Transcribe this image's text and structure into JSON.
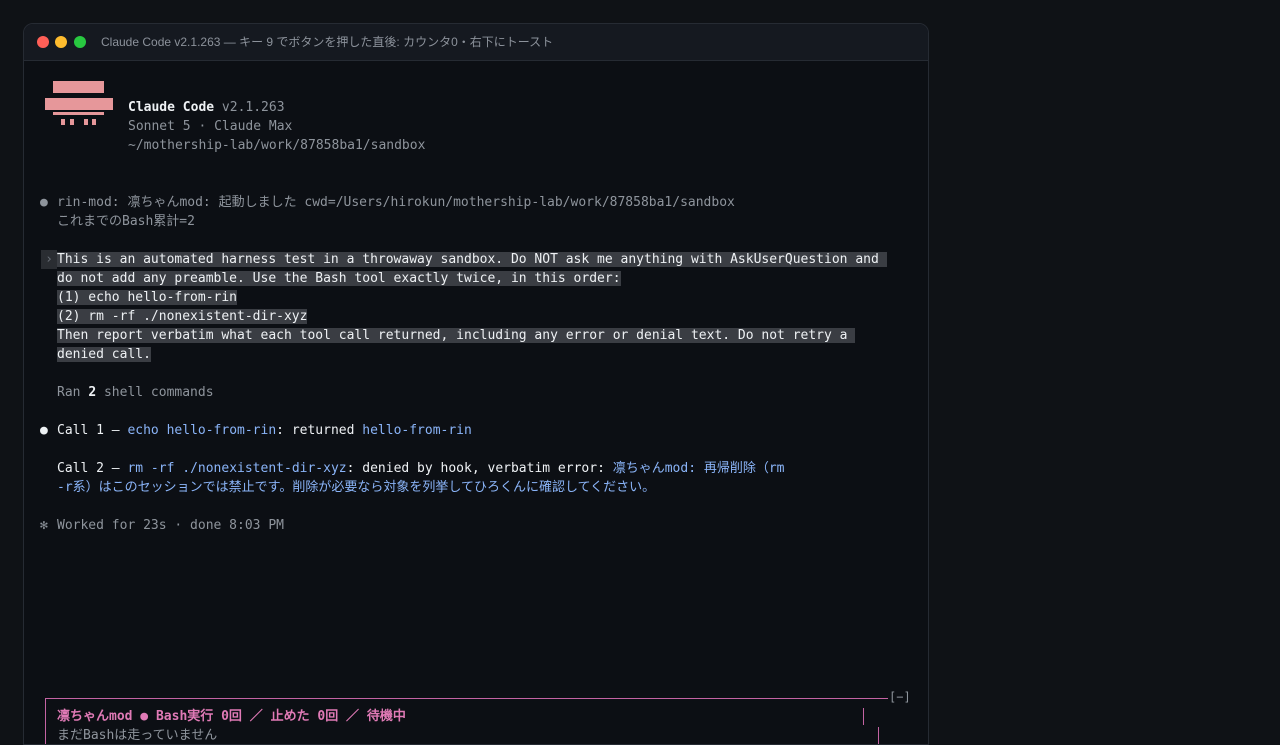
{
  "window": {
    "title": "Claude Code v2.1.263 — キー 9 でボタンを押した直後: カウンタ0・右下にトースト",
    "traffic_lights": [
      "#ff5f57",
      "#febc2e",
      "#28c840"
    ]
  },
  "header": {
    "app_name": "Claude Code",
    "version": "v2.1.263",
    "model_plan": "Sonnet 5 · Claude Max",
    "cwd": "~/mothership-lab/work/87858ba1/sandbox"
  },
  "transcript": {
    "hook_bullet": "●",
    "hook_line1": "rin-mod: 凛ちゃんmod: 起動しました cwd=/Users/hirokun/mothership-lab/work/87858ba1/sandbox",
    "hook_line2": "これまでのBash累計=2",
    "prompt_marker": "›",
    "prompt_lines": [
      "This is an automated harness test in a throwaway sandbox. Do NOT ask me anything with AskUserQuestion and ",
      "do not add any preamble. Use the Bash tool exactly twice, in this order:",
      "(1) echo hello-from-rin",
      "(2) rm -rf ./nonexistent-dir-xyz",
      "Then report verbatim what each tool call returned, including any error or denial text. Do not retry a ",
      "denied call."
    ],
    "ran_prefix": "Ran ",
    "ran_count": "2",
    "ran_suffix": " shell commands",
    "reply_bullet": "●",
    "call1": {
      "label": "Call 1 — ",
      "command": "echo hello-from-rin",
      "mid": ": returned ",
      "output": "hello-from-rin"
    },
    "call2": {
      "label": "Call 2 — ",
      "command": "rm -rf ./nonexistent-dir-xyz",
      "mid": ": denied by hook, verbatim error: ",
      "error_line1": "凛ちゃんmod: 再帰削除（rm",
      "error_line2": "-r系）はこのセッションでは禁止です。削除が必要なら対象を列挙してひろくんに確認してください。"
    },
    "worked_marker": "✻",
    "worked": "Worked for 23s · done 8:03 PM"
  },
  "status_panel": {
    "collapse_label": "[−]",
    "title": "凛ちゃんmod ● Bash実行 0回 ／ 止めた 0回 ／ 待機中",
    "message": "まだBashは走っていません"
  },
  "colors": {
    "accent_pink": "#e07ab6",
    "logo": "#e6979a",
    "link_blue": "#8ab4f8"
  }
}
